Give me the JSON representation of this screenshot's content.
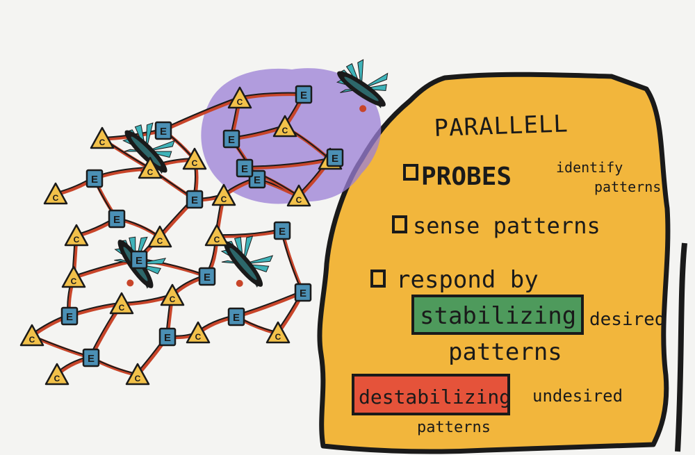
{
  "colors": {
    "background": "#f4f4f2",
    "panel": "#f2b63c",
    "constraint_fill": "#f2c14a",
    "element_fill": "#4b90b5",
    "link_red": "#c8452a",
    "cloud": "#9b7fd6",
    "probe_teal": "#3fb3b9",
    "stabilize_green": "#4e9a5c",
    "destabilize_red": "#e5533a",
    "ink": "#1a1a1a"
  },
  "network": {
    "constraint_letter": "C",
    "element_letter": "E"
  },
  "panel": {
    "title": "PARALLELL",
    "items": [
      {
        "main": "PROBES",
        "note_line1": "identify",
        "note_line2": "patterns"
      },
      {
        "main": "sense patterns"
      },
      {
        "main": "respond by"
      }
    ],
    "stabilize": {
      "label": "stabilizing",
      "note": "desired",
      "after": "patterns"
    },
    "destabilize": {
      "label": "destabilizing",
      "note": "undesired",
      "after": "patterns"
    }
  }
}
